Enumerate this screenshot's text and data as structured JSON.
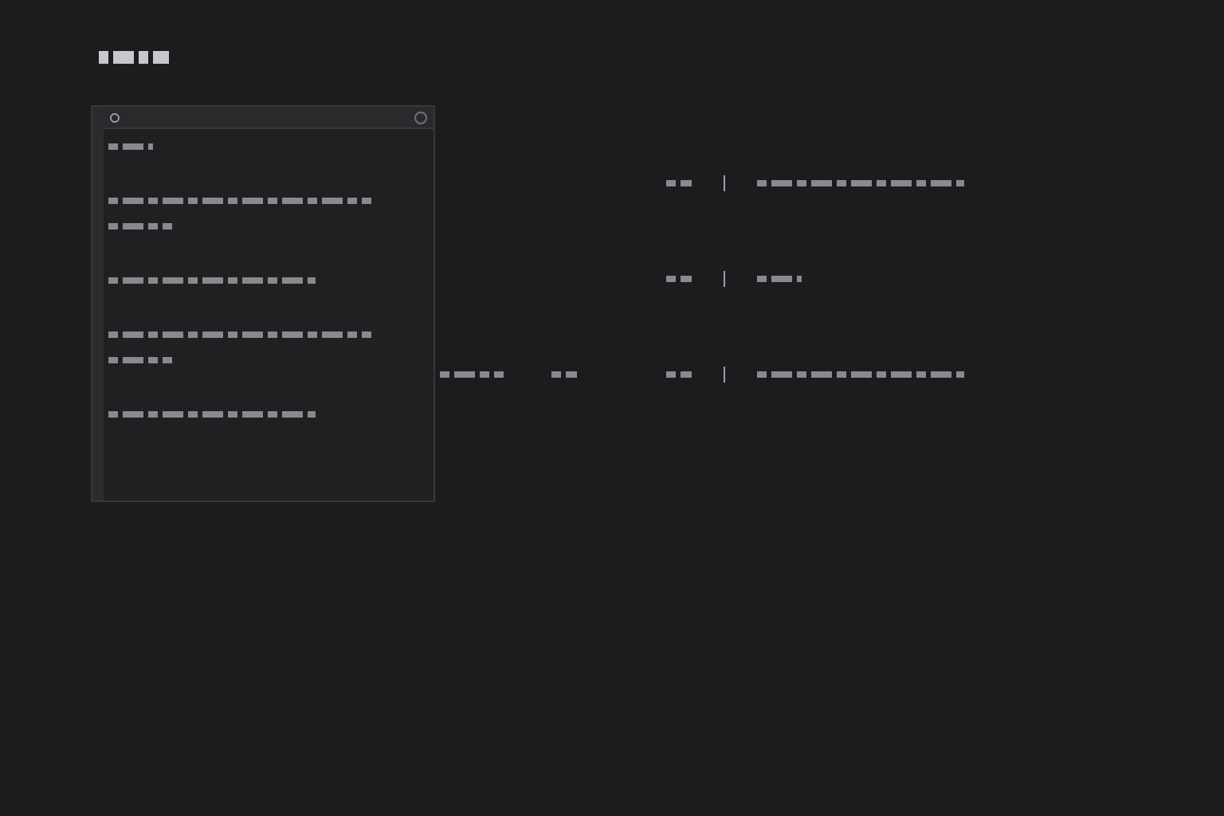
{
  "header": {
    "kind": "scribble-title"
  },
  "panel": {
    "entries": [
      {
        "kind": "short"
      },
      {
        "kind": "long-two"
      },
      {
        "kind": "long"
      },
      {
        "kind": "long-two"
      },
      {
        "kind": "long"
      }
    ]
  },
  "middle": [
    {
      "kind": "medium"
    },
    {
      "kind": "tiny"
    }
  ],
  "rows": [
    {
      "kind": "long"
    },
    {
      "kind": "short"
    },
    {
      "kind": "long"
    }
  ]
}
